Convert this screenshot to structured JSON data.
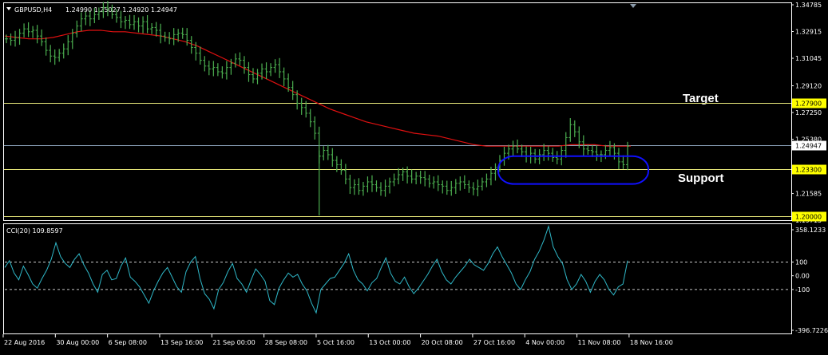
{
  "colors": {
    "background": "#000000",
    "price_bars": "#4caf50",
    "moving_average": "#e01010",
    "cci_line": "#2fb8c8",
    "horizontal_lines": "#e8e87a",
    "price_line": "#8aa0b8",
    "highlight_ellipse": "#1010ff",
    "price_tag_bg": "#ffff00"
  },
  "header": {
    "symbol_label": "GBPUSD,H4",
    "ohlc": "1.24990 1.25027 1.24920 1.24947",
    "collapse_icon": "triangle-down-icon",
    "scroll_marker_icon": "triangle-down-icon"
  },
  "annotations": {
    "target": "Target",
    "support": "Support"
  },
  "indicator": {
    "label": "CCI(20) 109.8597",
    "scale": [
      "358.1233",
      "100",
      "0.00",
      "-100",
      "-396.7226"
    ]
  },
  "chart_data": [
    {
      "type": "line",
      "title": "GBPUSD,H4",
      "series": [
        {
          "name": "GBPUSD",
          "values": [
            1.324,
            1.323,
            1.325,
            1.328,
            1.331,
            1.329,
            1.33,
            1.326,
            1.322,
            1.316,
            1.312,
            1.311,
            1.314,
            1.317,
            1.322,
            1.328,
            1.333,
            1.338,
            1.34,
            1.338,
            1.341,
            1.343,
            1.346,
            1.345,
            1.341,
            1.339,
            1.336,
            1.337,
            1.334,
            1.336,
            1.333,
            1.336,
            1.331,
            1.332,
            1.33,
            1.326,
            1.325,
            1.324,
            1.327,
            1.328,
            1.327,
            1.323,
            1.318,
            1.314,
            1.309,
            1.305,
            1.303,
            1.304,
            1.301,
            1.3,
            1.304,
            1.307,
            1.31,
            1.309,
            1.304,
            1.299,
            1.296,
            1.3,
            1.303,
            1.301,
            1.304,
            1.306,
            1.301,
            1.296,
            1.29,
            1.285,
            1.279,
            1.276,
            1.272,
            1.266,
            1.258,
            1.242,
            1.246,
            1.243,
            1.239,
            1.236,
            1.232,
            1.226,
            1.22,
            1.222,
            1.218,
            1.221,
            1.224,
            1.222,
            1.22,
            1.218,
            1.221,
            1.224,
            1.226,
            1.229,
            1.231,
            1.228,
            1.226,
            1.228,
            1.227,
            1.226,
            1.223,
            1.224,
            1.222,
            1.221,
            1.218,
            1.22,
            1.223,
            1.224,
            1.222,
            1.22,
            1.219,
            1.221,
            1.224,
            1.226,
            1.23,
            1.234,
            1.239,
            1.244,
            1.247,
            1.249,
            1.247,
            1.245,
            1.242,
            1.244,
            1.24,
            1.243,
            1.246,
            1.244,
            1.241,
            1.24,
            1.246,
            1.255,
            1.264,
            1.259,
            1.252,
            1.247,
            1.246,
            1.245,
            1.243,
            1.243,
            1.246,
            1.248,
            1.244,
            1.238,
            1.236,
            1.249
          ]
        },
        {
          "name": "MA",
          "values": [
            1.326,
            1.325,
            1.324,
            1.324,
            1.325,
            1.327,
            1.329,
            1.33,
            1.33,
            1.329,
            1.329,
            1.328,
            1.327,
            1.326,
            1.324,
            1.322,
            1.319,
            1.315,
            1.311,
            1.307,
            1.303,
            1.299,
            1.295,
            1.291,
            1.287,
            1.283,
            1.279,
            1.275,
            1.272,
            1.269,
            1.266,
            1.264,
            1.262,
            1.26,
            1.258,
            1.257,
            1.256,
            1.254,
            1.252,
            1.25,
            1.249,
            1.249,
            1.249,
            1.249,
            1.249,
            1.249,
            1.249,
            1.25,
            1.25,
            1.25,
            1.249,
            1.249,
            1.249
          ]
        }
      ],
      "xlabel": "",
      "ylabel": "",
      "ylim": [
        1.2,
        1.34785
      ],
      "y_ticks": [
        "1.34785",
        "1.32915",
        "1.31045",
        "1.29120",
        "1.27250",
        "1.25380",
        "1.23300",
        "1.21585",
        "1.19715"
      ],
      "x_ticks": [
        "22 Aug 2016",
        "30 Aug 00:00",
        "6 Sep 08:00",
        "13 Sep 16:00",
        "21 Sep 00:00",
        "28 Sep 08:00",
        "5 Oct 16:00",
        "13 Oct 00:00",
        "20 Oct 08:00",
        "27 Oct 16:00",
        "4 Nov 00:00",
        "11 Nov 08:00",
        "18 Nov 16:00"
      ],
      "horizontal_levels": [
        {
          "value": 1.279,
          "label": "1.27900"
        },
        {
          "value": 1.2494,
          "label": "1.24947"
        },
        {
          "value": 1.233,
          "label": "1.23300"
        },
        {
          "value": 1.2,
          "label": "1.20000"
        }
      ],
      "grid": false
    },
    {
      "type": "line",
      "title": "CCI(20) 109.8597",
      "series": [
        {
          "name": "CCI(20)",
          "values": [
            60,
            110,
            20,
            -30,
            70,
            10,
            -60,
            -90,
            -20,
            40,
            120,
            240,
            140,
            90,
            60,
            120,
            160,
            80,
            20,
            -60,
            -120,
            10,
            40,
            -30,
            -20,
            70,
            130,
            -10,
            -40,
            -80,
            -140,
            -200,
            -110,
            -40,
            20,
            60,
            -10,
            -80,
            -120,
            30,
            100,
            140,
            -20,
            -130,
            -170,
            -240,
            -100,
            -50,
            30,
            90,
            -20,
            -60,
            -120,
            -30,
            50,
            10,
            -40,
            -180,
            -210,
            -90,
            -30,
            20,
            -10,
            10,
            -60,
            -110,
            -200,
            -270,
            -100,
            -60,
            -20,
            -10,
            40,
            90,
            160,
            40,
            -30,
            -60,
            -110,
            -50,
            -20,
            60,
            130,
            20,
            -40,
            -60,
            -10,
            -80,
            -130,
            -90,
            -40,
            10,
            70,
            120,
            30,
            -30,
            -60,
            -10,
            30,
            70,
            120,
            80,
            60,
            40,
            90,
            160,
            210,
            140,
            80,
            20,
            -60,
            -100,
            -30,
            30,
            120,
            180,
            260,
            360,
            210,
            140,
            90,
            -30,
            -100,
            -60,
            10,
            -40,
            -120,
            -40,
            10,
            -30,
            -100,
            -140,
            -80,
            -60,
            110
          ]
        }
      ],
      "xlabel": "",
      "ylabel": "",
      "ylim": [
        -396.7226,
        358.1233
      ],
      "levels": [
        100,
        -100
      ],
      "grid": false
    }
  ]
}
